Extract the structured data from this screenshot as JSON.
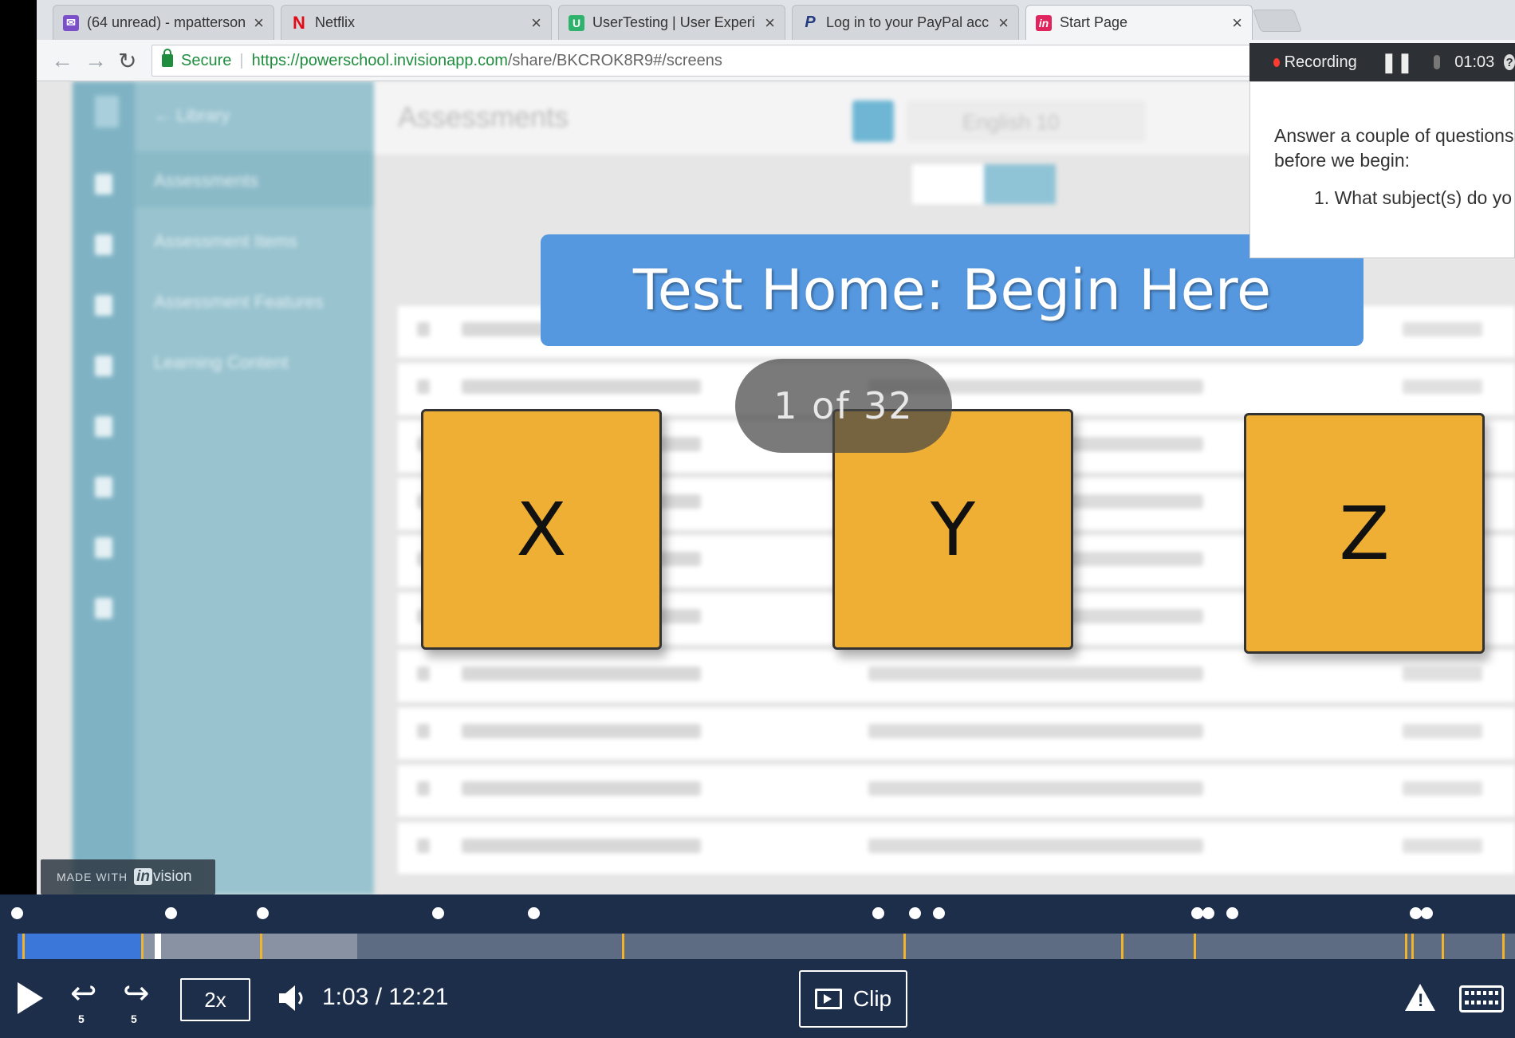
{
  "browser": {
    "tabs": [
      {
        "title": "(64 unread) - mpatterson",
        "favicon": "mail-icon",
        "color": "#7b4fc9"
      },
      {
        "title": "Netflix",
        "favicon": "netflix-icon",
        "color": "#e50914"
      },
      {
        "title": "UserTesting | User Experi",
        "favicon": "usertesting-icon",
        "color": "#2fb36c"
      },
      {
        "title": "Log in to your PayPal acc",
        "favicon": "paypal-icon",
        "color": "#253b80"
      },
      {
        "title": "Start Page",
        "favicon": "invision-icon",
        "color": "#e0245e"
      }
    ],
    "secure_label": "Secure",
    "url_host": "https://powerschool.invisionapp.com",
    "url_path": "/share/BKCROK8R9#/screens"
  },
  "app": {
    "back_label": "Library",
    "nav": [
      "Assessments",
      "Assessment Items",
      "Assessment Features",
      "Learning Content"
    ],
    "header_title": "Assessments",
    "course_select": "English 10",
    "made_with": "MADE WITH",
    "made_with_brand": "vision",
    "made_with_brand_mark": "in"
  },
  "overlay": {
    "banner": "Test Home: Begin Here",
    "counter": "1 of 32",
    "cards": [
      "X",
      "Y",
      "Z"
    ]
  },
  "recorder": {
    "status": "Recording",
    "elapsed": "01:03",
    "help": "?",
    "prompt_line1": "Answer a couple of questions",
    "prompt_line2": "before we begin:",
    "question_1": "1. What subject(s) do yo"
  },
  "player": {
    "speed": "2x",
    "time": "1:03 / 12:21",
    "clip_label": "Clip",
    "skip_back": "5",
    "skip_fwd": "5",
    "colors": {
      "bar": "#1d2e4a",
      "played": "#3b77d8",
      "tick": "#f0b42c"
    }
  }
}
